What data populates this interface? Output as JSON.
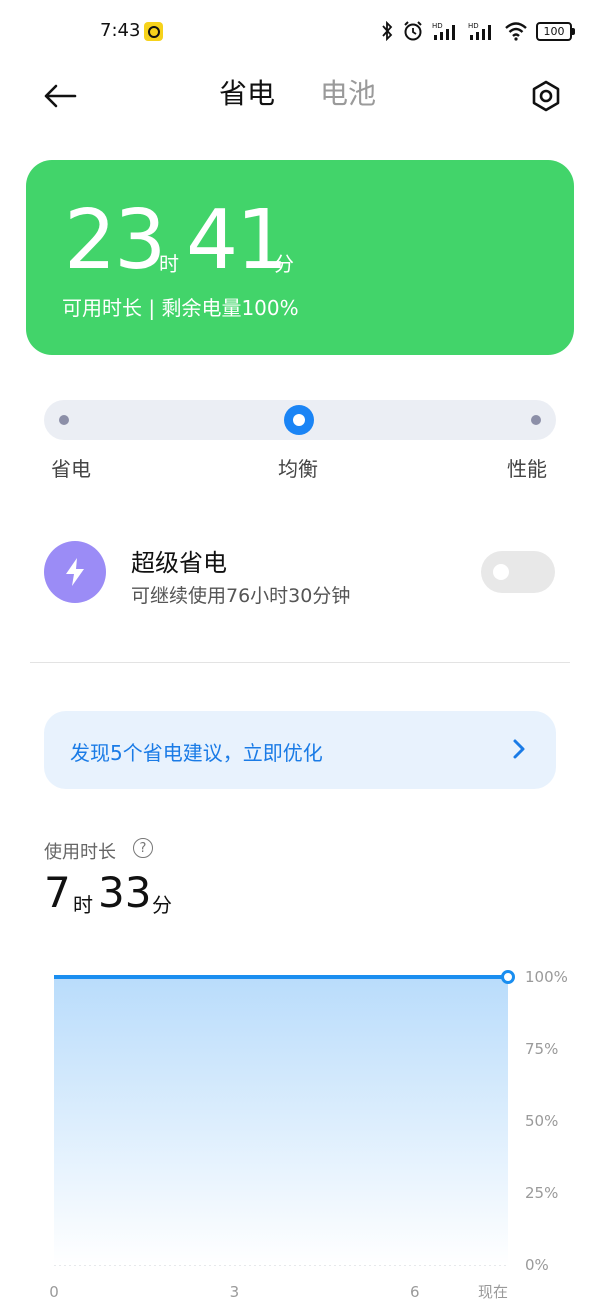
{
  "status_bar": {
    "time": "7:43",
    "battery": "100",
    "icons": [
      "bluetooth-icon",
      "alarm-icon",
      "signal-hd-icon",
      "signal-hd-icon",
      "wifi-icon",
      "battery-icon"
    ]
  },
  "header": {
    "tabs": [
      {
        "label": "省电",
        "active": true
      },
      {
        "label": "电池",
        "active": false
      }
    ]
  },
  "card": {
    "hours": "23",
    "hours_unit": "时",
    "minutes": "41",
    "minutes_unit": "分",
    "subtitle": "可用时长 | 剩余电量100%",
    "color": "#42d46a"
  },
  "modes": {
    "options": [
      "省电",
      "均衡",
      "性能"
    ],
    "selected": "均衡",
    "accent": "#1a84f5"
  },
  "super_saver": {
    "title": "超级省电",
    "subtitle": "可继续使用76小时30分钟",
    "enabled": false
  },
  "suggestion": {
    "text": "发现5个省电建议，立即优化"
  },
  "usage": {
    "label": "使用时长",
    "hours": "7",
    "hours_unit": "时",
    "minutes": "33",
    "minutes_unit": "分"
  },
  "chart_data": {
    "type": "area",
    "x": [
      0,
      7.55
    ],
    "y": [
      100,
      100
    ],
    "xticks": [
      "0",
      "3",
      "6",
      "现在"
    ],
    "xtick_values": [
      0,
      3,
      6,
      7.55
    ],
    "yticks": [
      "100%",
      "75%",
      "50%",
      "25%",
      "0%"
    ],
    "ylim": [
      0,
      100
    ],
    "xlim": [
      0,
      7.55
    ],
    "line_color": "#1a8ef0"
  }
}
